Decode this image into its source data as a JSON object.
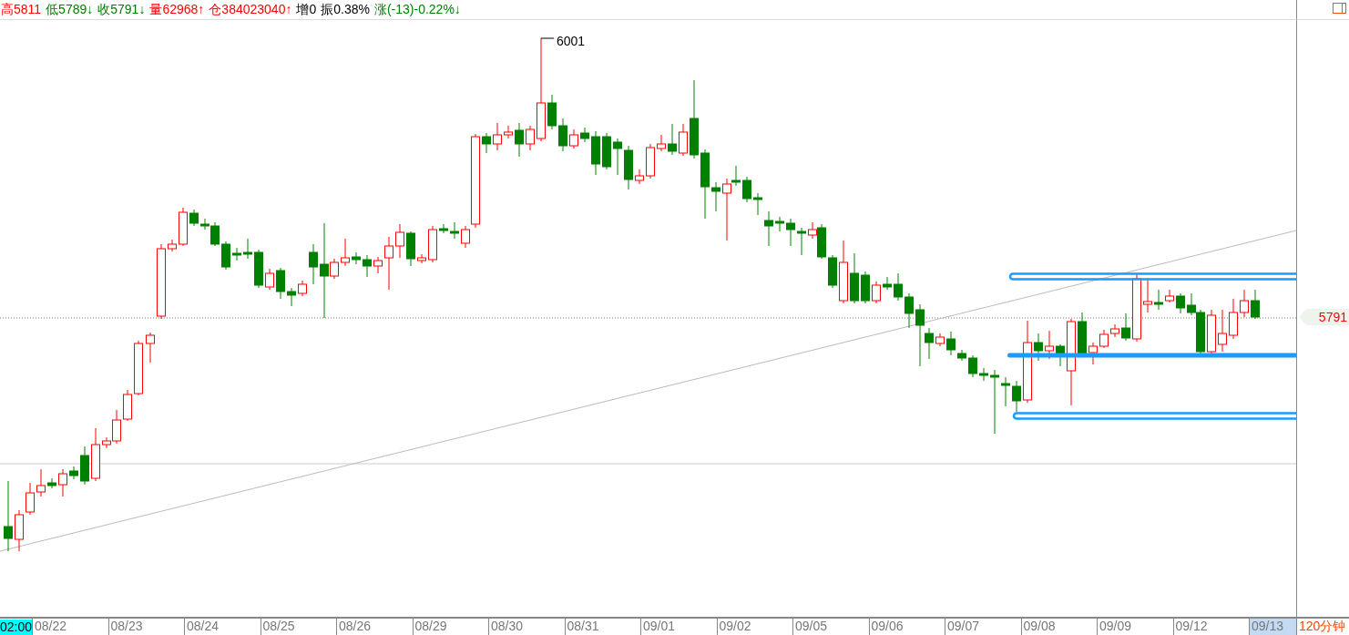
{
  "header": [
    {
      "label": "高5811",
      "color": "#ff0000"
    },
    {
      "label": "低5789↓",
      "color": "#008000"
    },
    {
      "label": "收5791↓",
      "color": "#008000"
    },
    {
      "label": "量62968↑",
      "color": "#ff0000"
    },
    {
      "label": "仓384023040↑",
      "color": "#ff0000"
    },
    {
      "label": "增0",
      "color": "#000000"
    },
    {
      "label": "振0.38%",
      "color": "#000000"
    },
    {
      "label": "涨(-13)-0.22%↓",
      "color": "#008000"
    }
  ],
  "chart": {
    "high_marker": "6001",
    "price_tag": "5791"
  },
  "time_axis": {
    "cursor_time": "02:00",
    "dates": [
      {
        "label": "08/22",
        "selected": false
      },
      {
        "label": "08/23",
        "selected": false
      },
      {
        "label": "08/24",
        "selected": false
      },
      {
        "label": "08/25",
        "selected": false
      },
      {
        "label": "08/26",
        "selected": false
      },
      {
        "label": "08/29",
        "selected": false
      },
      {
        "label": "08/30",
        "selected": false
      },
      {
        "label": "08/31",
        "selected": false
      },
      {
        "label": "09/01",
        "selected": false
      },
      {
        "label": "09/02",
        "selected": false
      },
      {
        "label": "09/05",
        "selected": false
      },
      {
        "label": "09/06",
        "selected": false
      },
      {
        "label": "09/07",
        "selected": false
      },
      {
        "label": "09/08",
        "selected": false
      },
      {
        "label": "09/09",
        "selected": false
      },
      {
        "label": "09/12",
        "selected": false
      },
      {
        "label": "09/13",
        "selected": true
      }
    ]
  },
  "period": "120分钟"
}
